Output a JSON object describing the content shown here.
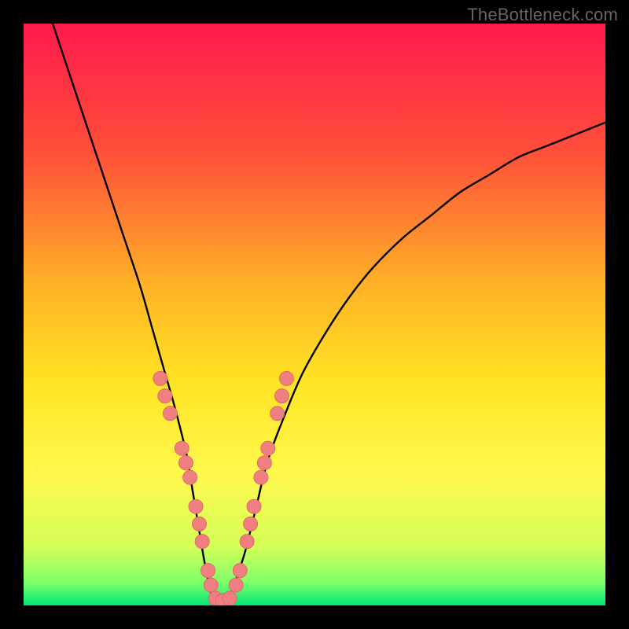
{
  "watermark": "TheBottleneck.com",
  "chart_data": {
    "type": "line",
    "title": "",
    "xlabel": "",
    "ylabel": "",
    "xlim": [
      0,
      100
    ],
    "ylim": [
      0,
      100
    ],
    "grid": false,
    "legend": false,
    "gradient_stops": [
      {
        "offset": 0,
        "color": "#ff1a4b"
      },
      {
        "offset": 22,
        "color": "#ff4f3a"
      },
      {
        "offset": 45,
        "color": "#ffb226"
      },
      {
        "offset": 62,
        "color": "#ffe524"
      },
      {
        "offset": 78,
        "color": "#fff94f"
      },
      {
        "offset": 90,
        "color": "#d3ff57"
      },
      {
        "offset": 96,
        "color": "#7fff6a"
      },
      {
        "offset": 100,
        "color": "#00e676"
      }
    ],
    "series": [
      {
        "name": "bottleneck-curve",
        "x": [
          5,
          8,
          11,
          14,
          17,
          20,
          22,
          24,
          26,
          28,
          29,
          30,
          31,
          32,
          33,
          34,
          35,
          36,
          38,
          40,
          42,
          45,
          48,
          52,
          56,
          60,
          65,
          70,
          75,
          80,
          85,
          90,
          95,
          100
        ],
        "y": [
          100,
          91,
          82,
          73,
          64,
          55,
          48,
          41,
          34,
          26,
          20,
          14,
          8,
          3,
          0,
          0,
          0,
          3,
          9,
          17,
          25,
          33,
          40,
          47,
          53,
          58,
          63,
          67,
          71,
          74,
          77,
          79,
          81,
          83
        ]
      }
    ],
    "markers": [
      {
        "x": 23.5,
        "y": 39
      },
      {
        "x": 24.3,
        "y": 36
      },
      {
        "x": 25.2,
        "y": 33
      },
      {
        "x": 27.2,
        "y": 27
      },
      {
        "x": 27.9,
        "y": 24.5
      },
      {
        "x": 28.6,
        "y": 22
      },
      {
        "x": 29.6,
        "y": 17
      },
      {
        "x": 30.2,
        "y": 14
      },
      {
        "x": 30.7,
        "y": 11
      },
      {
        "x": 31.7,
        "y": 6
      },
      {
        "x": 32.2,
        "y": 3.5
      },
      {
        "x": 33.0,
        "y": 1.2
      },
      {
        "x": 34.2,
        "y": 0.8
      },
      {
        "x": 35.4,
        "y": 1.2
      },
      {
        "x": 36.5,
        "y": 3.5
      },
      {
        "x": 37.2,
        "y": 6
      },
      {
        "x": 38.4,
        "y": 11
      },
      {
        "x": 39.0,
        "y": 14
      },
      {
        "x": 39.6,
        "y": 17
      },
      {
        "x": 40.8,
        "y": 22
      },
      {
        "x": 41.4,
        "y": 24.5
      },
      {
        "x": 42.0,
        "y": 27
      },
      {
        "x": 43.6,
        "y": 33
      },
      {
        "x": 44.4,
        "y": 36
      },
      {
        "x": 45.2,
        "y": 39
      }
    ],
    "marker_style": {
      "fill": "#f08080",
      "stroke": "#e06868",
      "radius": 9
    },
    "curve_style": {
      "stroke": "#000000",
      "width": 2.4
    }
  }
}
